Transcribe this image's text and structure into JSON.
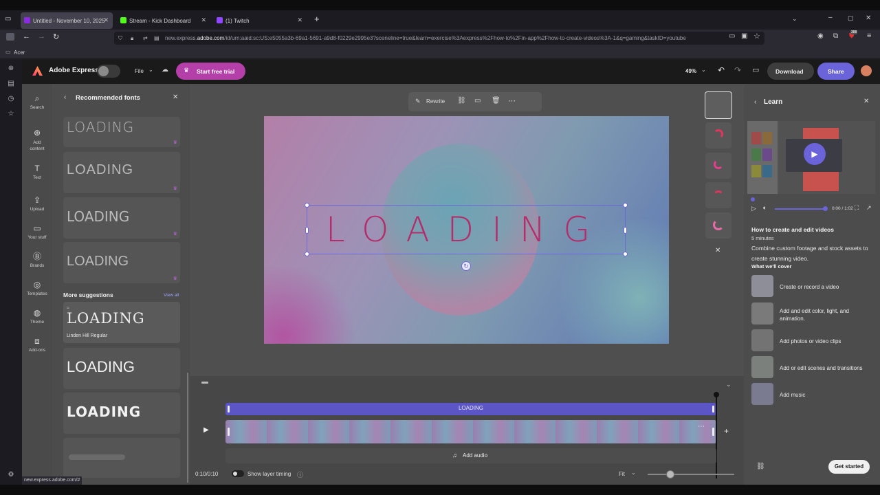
{
  "browser": {
    "tabs": [
      {
        "label": "Untitled - November 10, 2025 ·",
        "active": true,
        "favicon_color": "#8a2be2"
      },
      {
        "label": "Stream - Kick Dashboard",
        "active": false,
        "favicon_color": "#53fc18"
      },
      {
        "label": "(1) Twitch",
        "active": false,
        "favicon_color": "#9146ff"
      }
    ],
    "url_prefix": "new.express.",
    "url_domain": "adobe.com",
    "url_rest": "/id/urn:aaid:sc:US:e5055a3b-69a1-5691-a9d8-f0229e2995e3?sceneline=true&learn=exercise%3Aexpress%2Fhow-to%2Fin-app%2Fhow-to-create-videos%3A-1&q=gaming&taskID=youtube",
    "bookmark": "Acer",
    "status_url": "new.express.adobe.com/#",
    "badge_count": "388"
  },
  "header": {
    "app_name": "Adobe Express",
    "file_label": "File",
    "trial_label": "Start free trial",
    "zoom": "49%",
    "download_label": "Download",
    "share_label": "Share"
  },
  "tools": [
    {
      "label": "Search",
      "icon": "search-icon"
    },
    {
      "label": "Add content",
      "icon": "plus-circle-icon"
    },
    {
      "label": "Text",
      "icon": "text-icon"
    },
    {
      "label": "Upload",
      "icon": "upload-icon"
    },
    {
      "label": "Your stuff",
      "icon": "folder-icon"
    },
    {
      "label": "Brands",
      "icon": "brand-icon"
    },
    {
      "label": "Templates",
      "icon": "templates-icon"
    },
    {
      "label": "Theme",
      "icon": "theme-icon"
    },
    {
      "label": "Add-ons",
      "icon": "addons-icon"
    }
  ],
  "font_panel": {
    "title": "Recommended fonts",
    "recommended": [
      "LOADING",
      "LOADING",
      "LOADING",
      "LOADING"
    ],
    "more_title": "More suggestions",
    "view_all": "View all",
    "suggestions": [
      {
        "sample": "LOADING",
        "name": "Linden Hill Regular"
      },
      {
        "sample": "LOADING",
        "name": ""
      },
      {
        "sample": "LOADING",
        "name": ""
      }
    ]
  },
  "stage": {
    "toolbar_rewrite": "Rewrite",
    "canvas_text": "LOADING"
  },
  "timeline": {
    "text_track": "LOADING",
    "add_audio": "Add audio",
    "time": "0:10/0:10",
    "layer_timing": "Show layer timing",
    "fit": "Fit"
  },
  "learn": {
    "title": "Learn",
    "video_time": "0:00 / 1:02",
    "heading": "How to create and edit videos",
    "duration": "5 minutes",
    "description": "Combine custom footage and stock assets to create stunning video.",
    "cover_title": "What we'll cover",
    "steps": [
      "Create or record a video",
      "Add and edit color, light, and animation.",
      "Add photos or video clips",
      "Add or edit scenes and transitions",
      "Add music"
    ],
    "get_started": "Get started"
  },
  "colors": {
    "accent": "#6b63d9",
    "trial_pink": "#b53fa8",
    "selection": "#6d68d8"
  }
}
